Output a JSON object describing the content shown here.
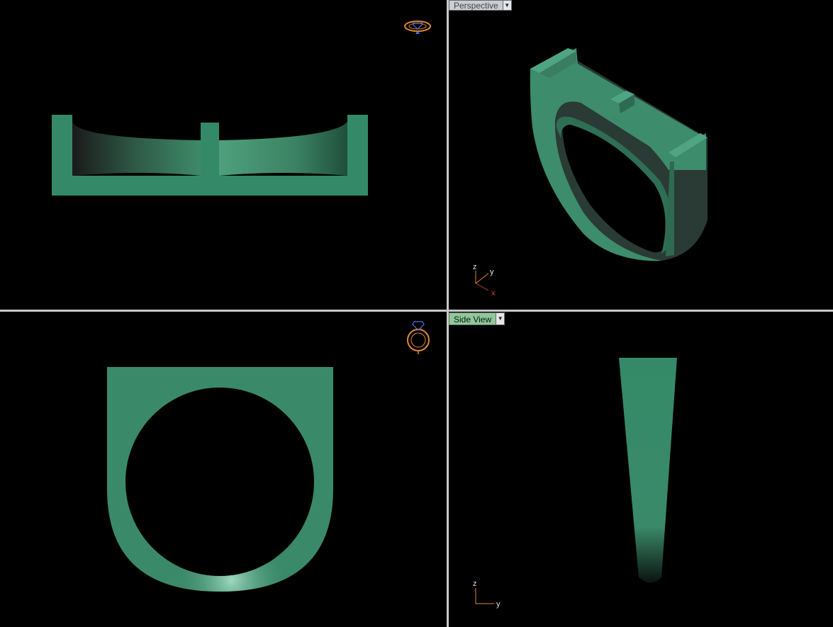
{
  "viewports": {
    "top": {
      "label": ""
    },
    "perspective": {
      "label": "Perspective",
      "axes": [
        "z",
        "y",
        "x"
      ]
    },
    "front": {
      "label": ""
    },
    "side": {
      "label": "Side View",
      "axes": [
        "z",
        "y"
      ]
    }
  },
  "colors": {
    "background": "#000000",
    "model": "#3a8a6a",
    "model_dark": "#1e4a3a",
    "gizmo": "#e08a30",
    "gem": "#4060d0",
    "divider": "#c8c8c8"
  },
  "icons": [
    "ring-gizmo-icon",
    "ring-gizmo-icon",
    "dropdown-arrow-icon",
    "axis-tripod-icon"
  ]
}
